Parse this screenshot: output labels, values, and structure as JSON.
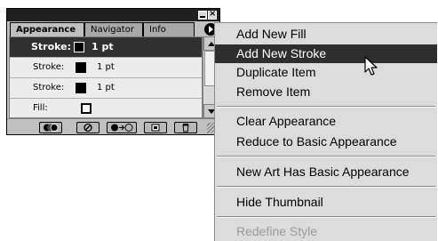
{
  "palette": {
    "tabs": [
      {
        "label": "Appearance",
        "active": true
      },
      {
        "label": "Navigator",
        "active": false
      },
      {
        "label": "Info",
        "active": false
      }
    ],
    "rows": [
      {
        "label": "Stroke:",
        "swatch": "black",
        "value": "1 pt",
        "selected": true
      },
      {
        "label": "Stroke:",
        "swatch": "black",
        "value": "1 pt",
        "selected": false
      },
      {
        "label": "Stroke:",
        "swatch": "black",
        "value": "1 pt",
        "selected": false
      },
      {
        "label": "Fill:",
        "swatch": "white",
        "value": "",
        "selected": false
      }
    ],
    "bottom_buttons": [
      "new-art-maintains-appearance-icon",
      "clear-appearance-icon",
      "reduce-to-basic-icon",
      "duplicate-item-icon",
      "delete-item-icon"
    ]
  },
  "menu": {
    "items": [
      {
        "label": "Add New Fill",
        "state": "normal"
      },
      {
        "label": "Add New Stroke",
        "state": "highlighted"
      },
      {
        "label": "Duplicate Item",
        "state": "normal"
      },
      {
        "label": "Remove Item",
        "state": "normal"
      },
      {
        "label": "Clear Appearance",
        "state": "normal"
      },
      {
        "label": "Reduce to Basic Appearance",
        "state": "normal"
      },
      {
        "label": "New Art Has Basic Appearance",
        "state": "normal"
      },
      {
        "label": "Hide Thumbnail",
        "state": "normal"
      },
      {
        "label": "Redefine Style",
        "state": "disabled"
      }
    ]
  },
  "colors": {
    "highlight": "#2e2e2e",
    "menu_bg": "#dcdcdc",
    "panel_bg": "#c0c0c0"
  }
}
